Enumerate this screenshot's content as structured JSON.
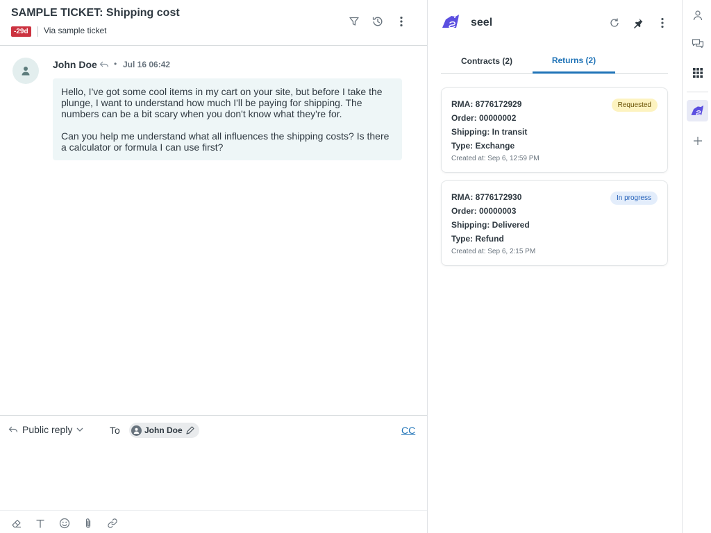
{
  "ticket": {
    "title": "SAMPLE TICKET: Shipping cost",
    "age_badge": "-29d",
    "channel": "Via sample ticket",
    "header_icons": [
      "filter-icon",
      "history-icon",
      "more-vertical-icon"
    ]
  },
  "message": {
    "author": "John Doe",
    "separator": "•",
    "timestamp": "Jul 16 06:42",
    "paragraphs": [
      "Hello, I've got some cool items in my cart on your site, but before I take the plunge, I want to understand how much I'll be paying for shipping. The numbers can be a bit scary when you don't know what they're for.",
      "Can you help me understand what all influences the shipping costs? Is there a calculator or formula I can use first?"
    ]
  },
  "composer": {
    "reply_type": "Public reply",
    "to_label": "To",
    "recipient": "John Doe",
    "cc_label": "CC",
    "toolbar_icons": [
      "eraser-icon",
      "text-format-icon",
      "emoji-icon",
      "paperclip-icon",
      "link-icon"
    ]
  },
  "app": {
    "name": "seel",
    "header_icons": [
      "refresh-icon",
      "pin-icon",
      "more-vertical-icon"
    ],
    "tabs": [
      {
        "label": "Contracts (2)",
        "active": false
      },
      {
        "label": "Returns (2)",
        "active": true
      }
    ],
    "returns": [
      {
        "rma": "RMA: 8776172929",
        "order": "Order: 00000002",
        "shipping": "Shipping: In transit",
        "type": "Type: Exchange",
        "created": "Created at: Sep 6, 12:59 PM",
        "status": "Requested",
        "status_color": "#fdf3c0"
      },
      {
        "rma": "RMA: 8776172930",
        "order": "Order: 00000003",
        "shipping": "Shipping: Delivered",
        "type": "Type: Refund",
        "created": "Created at: Sep 6, 2:15 PM",
        "status": "In progress",
        "status_color": "#e3edfb"
      }
    ]
  },
  "rail": {
    "icons": [
      "user-icon",
      "conversations-icon",
      "apps-grid-icon",
      "seel-app-icon",
      "plus-icon"
    ]
  },
  "colors": {
    "accent": "#1f73b7",
    "age_badge": "#cc3340",
    "bubble": "#eef6f7",
    "brand_purple": "#5b4fe0"
  }
}
